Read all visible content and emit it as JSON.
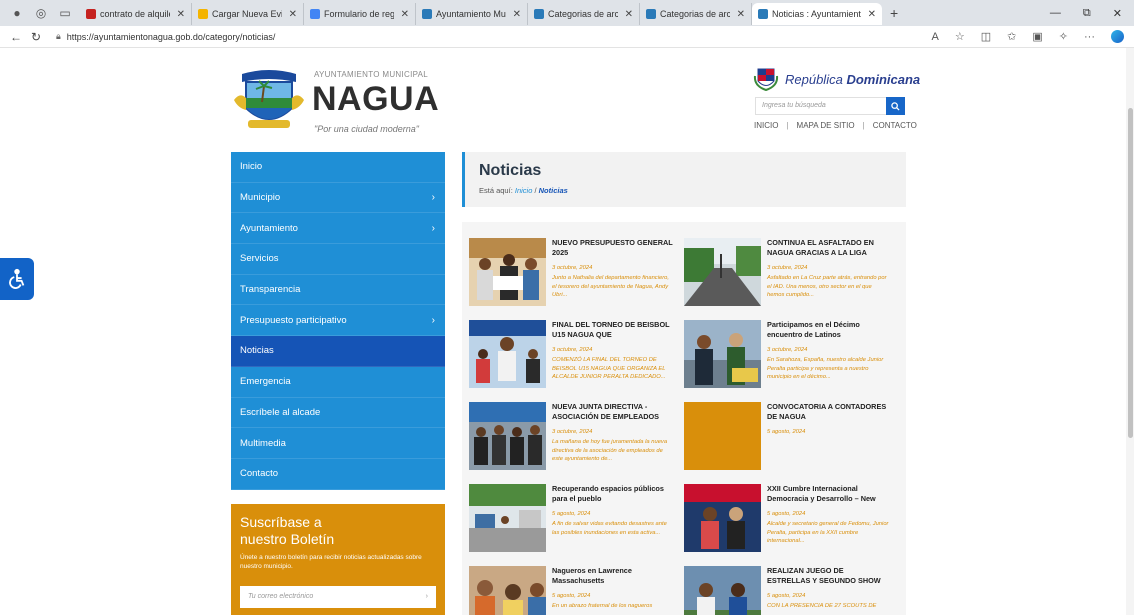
{
  "browser": {
    "tabs": [
      {
        "label": "contrato de alquiler - karolinnc",
        "color": "#c5221f"
      },
      {
        "label": "Cargar Nueva Evidencia - SISM",
        "color": "#f4b400"
      },
      {
        "label": "Formulario de registro de OAI.",
        "color": "#4285f4"
      },
      {
        "label": "Ayuntamiento Municipal de Na",
        "color": "#2a7ab8"
      },
      {
        "label": "Categorias de archivos Publica",
        "color": "#2a7ab8"
      },
      {
        "label": "Categorias de archivos Base Le",
        "color": "#2a7ab8"
      },
      {
        "label": "Noticias : Ayuntamiento Munic",
        "color": "#2a7ab8"
      }
    ],
    "url": "https://ayuntamientonagua.gob.do/category/noticias/"
  },
  "header": {
    "brand_small": "AYUNTAMIENTO MUNICIPAL",
    "brand_big": "NAGUA",
    "slogan": "\"Por una ciudad moderna\"",
    "country_prefix": "República ",
    "country_bold": "Dominicana",
    "search_placeholder": "Ingresa tu búsqueda",
    "top_links": [
      "INICIO",
      "MAPA DE SITIO",
      "CONTACTO"
    ]
  },
  "sidebar": {
    "items": [
      {
        "label": "Inicio",
        "chevron": ""
      },
      {
        "label": "Municipio",
        "chevron": "›"
      },
      {
        "label": "Ayuntamiento",
        "chevron": "›"
      },
      {
        "label": "Servicios",
        "chevron": ""
      },
      {
        "label": "Transparencia",
        "chevron": ""
      },
      {
        "label": "Presupuesto participativo",
        "chevron": "›"
      },
      {
        "label": "Noticias",
        "chevron": ""
      },
      {
        "label": "Emergencia",
        "chevron": ""
      },
      {
        "label": "Escríbele al alcade",
        "chevron": ""
      },
      {
        "label": "Multimedia",
        "chevron": ""
      },
      {
        "label": "Contacto",
        "chevron": ""
      }
    ],
    "active_index": 6
  },
  "newsletter": {
    "title_line1": "Suscríbase a",
    "title_line2": "nuestro Boletín",
    "description": "Únete a nuestro boletín para recibir noticias actualizadas sobre nuestro municipio.",
    "placeholder": "Tu correo electrónico",
    "arrow": "›"
  },
  "main": {
    "title": "Noticias",
    "crumb_prefix": "Está aquí: ",
    "crumb_home": "Inicio",
    "crumb_sep": " / ",
    "crumb_current": "Noticias"
  },
  "news": [
    {
      "title": "NUEVO PRESUPUESTO GENERAL 2025",
      "date": "3 octubre, 2024",
      "excerpt": "Junto a Nathalia del departamento financiero, el tesorero del ayuntamiento de Nagua, Andy Ubri...",
      "thumb": "people"
    },
    {
      "title": "CONTINUA EL ASFALTADO EN NAGUA GRACIAS A LA LIGA",
      "date": "3 octubre, 2024",
      "excerpt": "Asfaltado en La Cruz parte atrás, entrando por el IAD. Una menos, otro sector en el que hemos cumplido...",
      "thumb": "street"
    },
    {
      "title": "FINAL DEL TORNEO DE BEISBOL U15 NAGUA QUE",
      "date": "3 octubre, 2024",
      "excerpt": "COMENZÓ LA FINAL DEL TORNEO DE BEISBOL U15 NAGUA QUE ORGANIZA EL ALCALDE JUNIOR PERALTA DEDICADO...",
      "thumb": "baseball"
    },
    {
      "title": "Participamos en el Décimo encuentro de Latinos",
      "date": "3 octubre, 2024",
      "excerpt": "En Sarahoza, España, nuestro alcalde Junior Peralta participa y representa a nuestro municipio en el décimo...",
      "thumb": "event"
    },
    {
      "title": "NUEVA JUNTA DIRECTIVA - ASOCIACIÓN DE EMPLEADOS",
      "date": "3 octubre, 2024",
      "excerpt": "La mañana de hoy fue juramentada la nueva directiva de la asociación de empleados de este ayuntamiento de...",
      "thumb": "group"
    },
    {
      "title": "CONVOCATORIA A CONTADORES DE NAGUA",
      "date": "5 agosto, 2024",
      "excerpt": "",
      "thumb": "orange"
    },
    {
      "title": "Recuperando espacios públicos para el pueblo",
      "date": "5 agosto, 2024",
      "excerpt": "A fin de salvar vidas evitando desastres ante las posibles inundaciones en esta activa...",
      "thumb": "outdoor"
    },
    {
      "title": "XXII Cumbre Internacional Democracia y Desarrollo – New",
      "date": "5 agosto, 2024",
      "excerpt": "Alcalde y secretario general de Fedomu, Junior Peralta, participa en la XXII cumbre internacional...",
      "thumb": "summit"
    },
    {
      "title": "Nagueros en Lawrence Massachusetts",
      "date": "5 agosto, 2024",
      "excerpt": "En un abrazo fraternal de los nagueros",
      "thumb": "crowd"
    },
    {
      "title": "REALIZAN JUEGO DE ESTRELLAS Y SEGUNDO SHOW",
      "date": "5 agosto, 2024",
      "excerpt": "CON LA PRESENCIA DE 27 SCOUTS DE",
      "thumb": "players"
    }
  ]
}
